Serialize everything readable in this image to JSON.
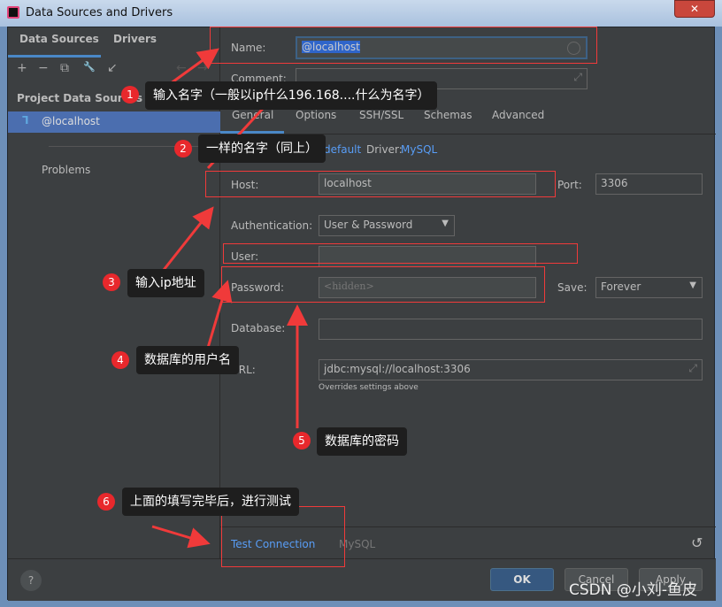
{
  "window": {
    "title": "Data Sources and Drivers",
    "close": "✕"
  },
  "sidebar": {
    "tabs": [
      "Data Sources",
      "Drivers"
    ],
    "tools": [
      "+",
      "−",
      "⧉",
      "🔧",
      "↙",
      "←",
      "→"
    ],
    "section": "Project Data Sources",
    "item": "@localhost",
    "problems": "Problems"
  },
  "form": {
    "name_label": "Name:",
    "name_value": "@localhost",
    "comment_label": "Comment:",
    "tabs": [
      "General",
      "Options",
      "SSH/SSL",
      "Schemas",
      "Advanced"
    ],
    "template_link": "default",
    "driver_label": "Driver:",
    "driver_link": "MySQL",
    "host_label": "Host:",
    "host_value": "localhost",
    "port_label": "Port:",
    "port_value": "3306",
    "auth_label": "Authentication:",
    "auth_value": "User & Password",
    "user_label": "User:",
    "user_value": "",
    "password_label": "Password:",
    "password_placeholder": "<hidden>",
    "save_label": "Save:",
    "save_value": "Forever",
    "database_label": "Database:",
    "database_value": "",
    "url_label": "URL:",
    "url_value": "jdbc:mysql://localhost:3306",
    "url_hint": "Overrides settings above",
    "test_connection": "Test Connection",
    "driver_footer": "MySQL",
    "reset": "↺"
  },
  "footer": {
    "help": "?",
    "ok": "OK",
    "cancel": "Cancel",
    "apply": "Apply"
  },
  "annotations": [
    {
      "n": "1",
      "text": "输入名字（一般以ip什么196.168....什么为名字）"
    },
    {
      "n": "2",
      "text": "一样的名字（同上）"
    },
    {
      "n": "3",
      "text": "输入ip地址"
    },
    {
      "n": "4",
      "text": "数据库的用户名"
    },
    {
      "n": "5",
      "text": "数据库的密码"
    },
    {
      "n": "6",
      "text": "上面的填写完毕后，进行测试"
    }
  ],
  "watermark": "CSDN @小刘-鱼皮",
  "colors": {
    "accent": "#4a88c7",
    "selection": "#4b6eaf",
    "annotation": "#f03a3a",
    "link": "#589df6"
  }
}
